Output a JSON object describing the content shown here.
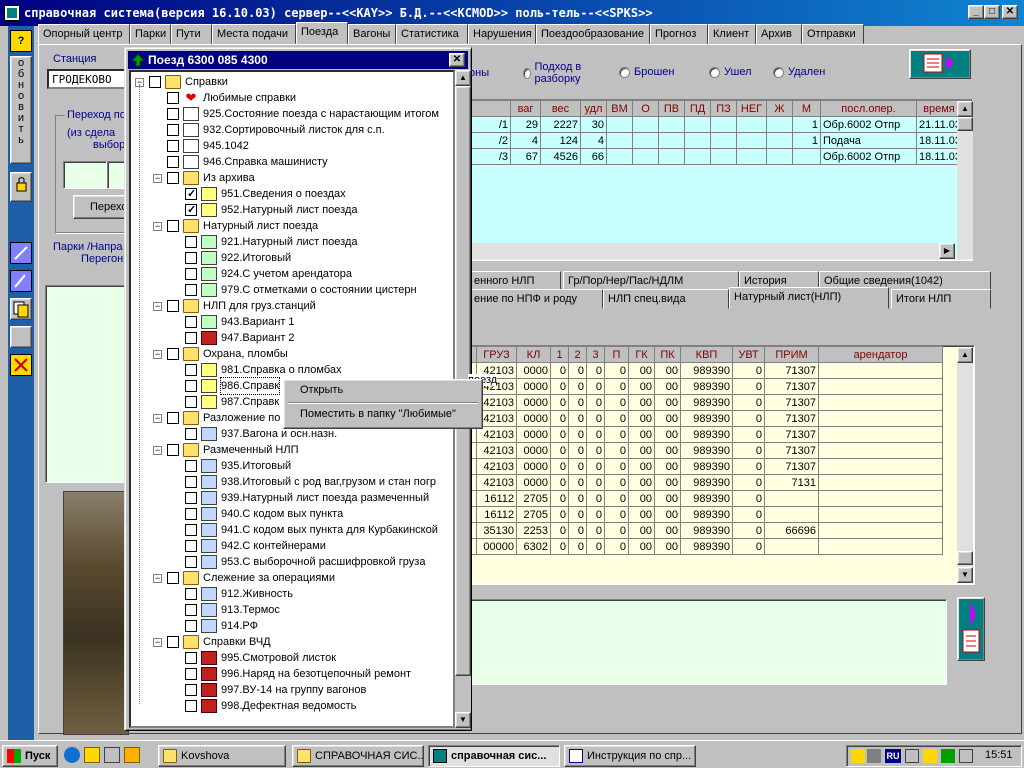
{
  "window": {
    "title": "справочная система(версия 16.10.03) сервер--<<KAY>> Б.Д.--<<KCMOD>> поль-тель--<<SPKS>>"
  },
  "left_toolbar": {
    "help_label": "?",
    "refresh_label": "обновить"
  },
  "tabs": [
    "Опорный центр",
    "Парки",
    "Пути",
    "Места подачи",
    "Поезда",
    "Вагоны",
    "Статистика",
    "Нарушения",
    "Поездообразование",
    "Прогноз",
    "Клиент",
    "Архив",
    "Отправки"
  ],
  "active_tab": "Поезда",
  "form": {
    "station_label": "Станция",
    "station_value": "ГРОДЕКОВО",
    "transition_label": "Переход по",
    "transition_hint1": "(из сдела",
    "transition_hint2": "выбор",
    "transition_button": "Перехо",
    "parks_label": "Парки /Напра",
    "peregon_label": "Перегон"
  },
  "radios": [
    "оны",
    "Подход в разборку",
    "Брошен",
    "Ушел",
    "Удален"
  ],
  "top_table": {
    "headers": [
      "",
      "ваг",
      "вес",
      "удл",
      "ВМ",
      "О",
      "ПВ",
      "ПД",
      "ПЗ",
      "НЕГ",
      "Ж",
      "М",
      "посл.опер.",
      "время о"
    ],
    "rows": [
      [
        "/1",
        "29",
        "2227",
        "30",
        "",
        "",
        "",
        "",
        "",
        "",
        "",
        "1",
        "Обр.6002 Отпр",
        "21.11.03"
      ],
      [
        "/2",
        "4",
        "124",
        "4",
        "",
        "",
        "",
        "",
        "",
        "",
        "",
        "1",
        "Подача",
        "18.11.03"
      ],
      [
        "/3",
        "67",
        "4526",
        "66",
        "",
        "",
        "",
        "",
        "",
        "",
        "",
        "",
        "Обр.6002 Отпр",
        "18.11.03"
      ]
    ]
  },
  "subtabs_row1": [
    "енного НЛП",
    "Гр/Пор/Нер/Пас/НДЛМ",
    "История",
    "Общие сведения(1042)"
  ],
  "subtabs_row2": [
    "ение по НПФ и роду",
    "НЛП спец.вида",
    "Натурный лист(НЛП)",
    "Итоги НЛП"
  ],
  "bottom_table": {
    "headers": [
      "",
      "ГРУЗ",
      "КЛ",
      "1",
      "2",
      "3",
      "П",
      "ГК",
      "ПК",
      "КВП",
      "УВТ",
      "ПРИМ",
      "арендатор"
    ],
    "rows": [
      [
        "",
        "42103",
        "0000",
        "0",
        "0",
        "0",
        "0",
        "00",
        "00",
        "989390",
        "0",
        "71307",
        ""
      ],
      [
        "",
        "42103",
        "0000",
        "0",
        "0",
        "0",
        "0",
        "00",
        "00",
        "989390",
        "0",
        "71307",
        ""
      ],
      [
        "",
        "42103",
        "0000",
        "0",
        "0",
        "0",
        "0",
        "00",
        "00",
        "989390",
        "0",
        "71307",
        ""
      ],
      [
        "",
        "42103",
        "0000",
        "0",
        "0",
        "0",
        "0",
        "00",
        "00",
        "989390",
        "0",
        "71307",
        ""
      ],
      [
        "",
        "42103",
        "0000",
        "0",
        "0",
        "0",
        "0",
        "00",
        "00",
        "989390",
        "0",
        "71307",
        ""
      ],
      [
        "",
        "42103",
        "0000",
        "0",
        "0",
        "0",
        "0",
        "00",
        "00",
        "989390",
        "0",
        "71307",
        ""
      ],
      [
        "",
        "42103",
        "0000",
        "0",
        "0",
        "0",
        "0",
        "00",
        "00",
        "989390",
        "0",
        "71307",
        ""
      ],
      [
        "",
        "42103",
        "0000",
        "0",
        "0",
        "0",
        "0",
        "00",
        "00",
        "989390",
        "0",
        "7131",
        ""
      ],
      [
        "",
        "16112",
        "2705",
        "0",
        "0",
        "0",
        "0",
        "00",
        "00",
        "989390",
        "0",
        "",
        ""
      ],
      [
        "",
        "16112",
        "2705",
        "0",
        "0",
        "0",
        "0",
        "00",
        "00",
        "989390",
        "0",
        "",
        ""
      ],
      [
        "",
        "35130",
        "2253",
        "0",
        "0",
        "0",
        "0",
        "00",
        "00",
        "989390",
        "0",
        "66696",
        ""
      ],
      [
        "",
        "00000",
        "6302",
        "0",
        "0",
        "0",
        "0",
        "00",
        "00",
        "989390",
        "0",
        "",
        ""
      ]
    ]
  },
  "popup": {
    "title": "Поезд 6300 085 4300",
    "tree": [
      {
        "level": 0,
        "kind": "folder",
        "label": "Справки",
        "expander": "−"
      },
      {
        "level": 1,
        "kind": "heart",
        "label": "Любимые справки"
      },
      {
        "level": 1,
        "kind": "doc",
        "label": "925.Состояние поезда с нарастающим итогом"
      },
      {
        "level": 1,
        "kind": "doc",
        "label": "932.Сортировочный листок для с.п."
      },
      {
        "level": 1,
        "kind": "doc",
        "label": "945.1042"
      },
      {
        "level": 1,
        "kind": "doc",
        "label": "946.Справка машинисту"
      },
      {
        "level": 1,
        "kind": "folder",
        "label": "Из архива",
        "expander": "−"
      },
      {
        "level": 2,
        "kind": "docy",
        "label": "951.Сведения о поездах",
        "checked": true
      },
      {
        "level": 2,
        "kind": "docy",
        "label": "952.Натурный лист поезда",
        "checked": true
      },
      {
        "level": 1,
        "kind": "folder",
        "label": "Натурный лист поезда",
        "expander": "−"
      },
      {
        "level": 2,
        "kind": "docg",
        "label": "921.Натурный лист поезда"
      },
      {
        "level": 2,
        "kind": "docg",
        "label": "922.Итоговый"
      },
      {
        "level": 2,
        "kind": "docg",
        "label": "924.С учетом арендатора"
      },
      {
        "level": 2,
        "kind": "docg",
        "label": "979.С отметками о состоянии цистерн"
      },
      {
        "level": 1,
        "kind": "folder",
        "label": "НЛП для груз.станций",
        "expander": "−"
      },
      {
        "level": 2,
        "kind": "docg",
        "label": "943.Вариант 1"
      },
      {
        "level": 2,
        "kind": "docr",
        "label": "947.Вариант 2"
      },
      {
        "level": 1,
        "kind": "folder",
        "label": "Охрана, пломбы",
        "expander": "−"
      },
      {
        "level": 2,
        "kind": "docy",
        "label": "981.Справка о пломбах"
      },
      {
        "level": 2,
        "kind": "docy",
        "label": "986.Справк",
        "selected": true
      },
      {
        "level": 2,
        "kind": "docy",
        "label": "987.Справк"
      },
      {
        "level": 1,
        "kind": "folder",
        "label": "Разложение по",
        "expander": "−"
      },
      {
        "level": 2,
        "kind": "docb",
        "label": "937.Вагона и осн.назн."
      },
      {
        "level": 1,
        "kind": "folder",
        "label": "Размеченный НЛП",
        "expander": "−"
      },
      {
        "level": 2,
        "kind": "docb",
        "label": "935.Итоговый"
      },
      {
        "level": 2,
        "kind": "docb",
        "label": "938.Итоговый с род ваг,грузом и  стан погр"
      },
      {
        "level": 2,
        "kind": "docb",
        "label": "939.Натурный лист поезда размеченный"
      },
      {
        "level": 2,
        "kind": "docb",
        "label": "940.С кодом вых пункта"
      },
      {
        "level": 2,
        "kind": "docb",
        "label": "941.С кодом вых пункта для Курбакинской"
      },
      {
        "level": 2,
        "kind": "docb",
        "label": "942.С контейнерами"
      },
      {
        "level": 2,
        "kind": "docb",
        "label": "953.С выборочной расшифровкой груза"
      },
      {
        "level": 1,
        "kind": "folder",
        "label": "Слежение за операциями",
        "expander": "−"
      },
      {
        "level": 2,
        "kind": "docb",
        "label": "912.Живность"
      },
      {
        "level": 2,
        "kind": "docb",
        "label": "913.Термос"
      },
      {
        "level": 2,
        "kind": "docb",
        "label": "914.РФ"
      },
      {
        "level": 1,
        "kind": "folder",
        "label": "Справки ВЧД",
        "expander": "−"
      },
      {
        "level": 2,
        "kind": "docr",
        "label": "995.Смотровой листок"
      },
      {
        "level": 2,
        "kind": "docr",
        "label": "996.Наряд на безотцепочный ремонт"
      },
      {
        "level": 2,
        "kind": "docr",
        "label": "997.ВУ-14 на группу вагонов"
      },
      {
        "level": 2,
        "kind": "docr",
        "label": "998.Дефектная ведомость"
      }
    ],
    "selected_overflow": "поезд"
  },
  "context_menu": {
    "items": [
      "Открыть",
      "Поместить в папку \"Любимые\""
    ]
  },
  "taskbar": {
    "start_label": "Пуск",
    "items": [
      "Kovshova",
      "СПРАВОЧНАЯ СИС...",
      "справочная сис...",
      "Инструкция по спр..."
    ],
    "active_index": 2,
    "tray_lang": "RU",
    "clock": "15:51"
  },
  "colors": {
    "title_blue": "#000080",
    "teal_desktop": "#008080",
    "grid_row": "#ffffe0",
    "top_grid_row": "#c8ffff",
    "header_text": "#800000"
  }
}
